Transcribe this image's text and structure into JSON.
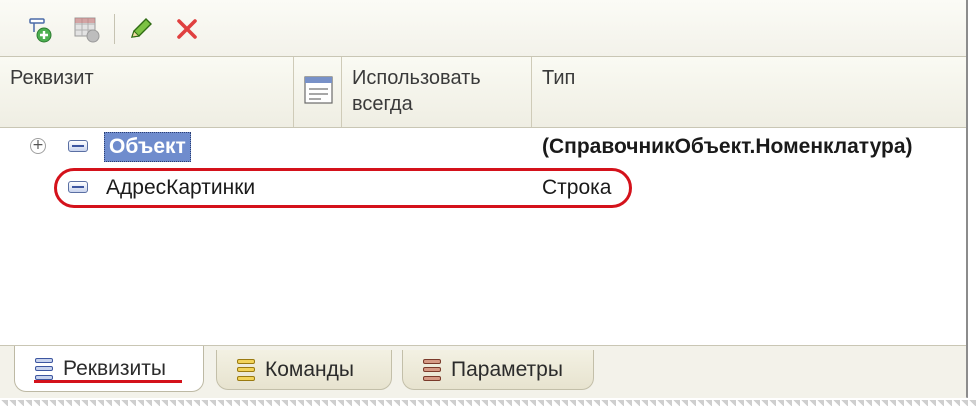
{
  "toolbar": {
    "buttons": [
      {
        "name": "add-attribute-button",
        "icon": "add-row-icon"
      },
      {
        "name": "add-table-button",
        "icon": "add-table-icon"
      },
      {
        "name": "edit-button",
        "icon": "pencil-icon"
      },
      {
        "name": "delete-button",
        "icon": "delete-x-icon"
      }
    ]
  },
  "table": {
    "columns": [
      "Реквизит",
      "",
      "Использовать всегда",
      "Тип"
    ],
    "rows": [
      {
        "name": "Объект",
        "type": "(СправочникОбъект.Номенклатура)",
        "expanded": false,
        "selected": true
      },
      {
        "name": "АдресКартинки",
        "type": "Строка",
        "highlighted": true
      }
    ]
  },
  "tabs": [
    {
      "label": "Реквизиты",
      "active": true
    },
    {
      "label": "Команды",
      "active": false
    },
    {
      "label": "Параметры",
      "active": false
    }
  ],
  "colors": {
    "selection": "#6f8ccd",
    "highlight": "#d4121b",
    "toolbar_bg": "#f3f2ea"
  }
}
